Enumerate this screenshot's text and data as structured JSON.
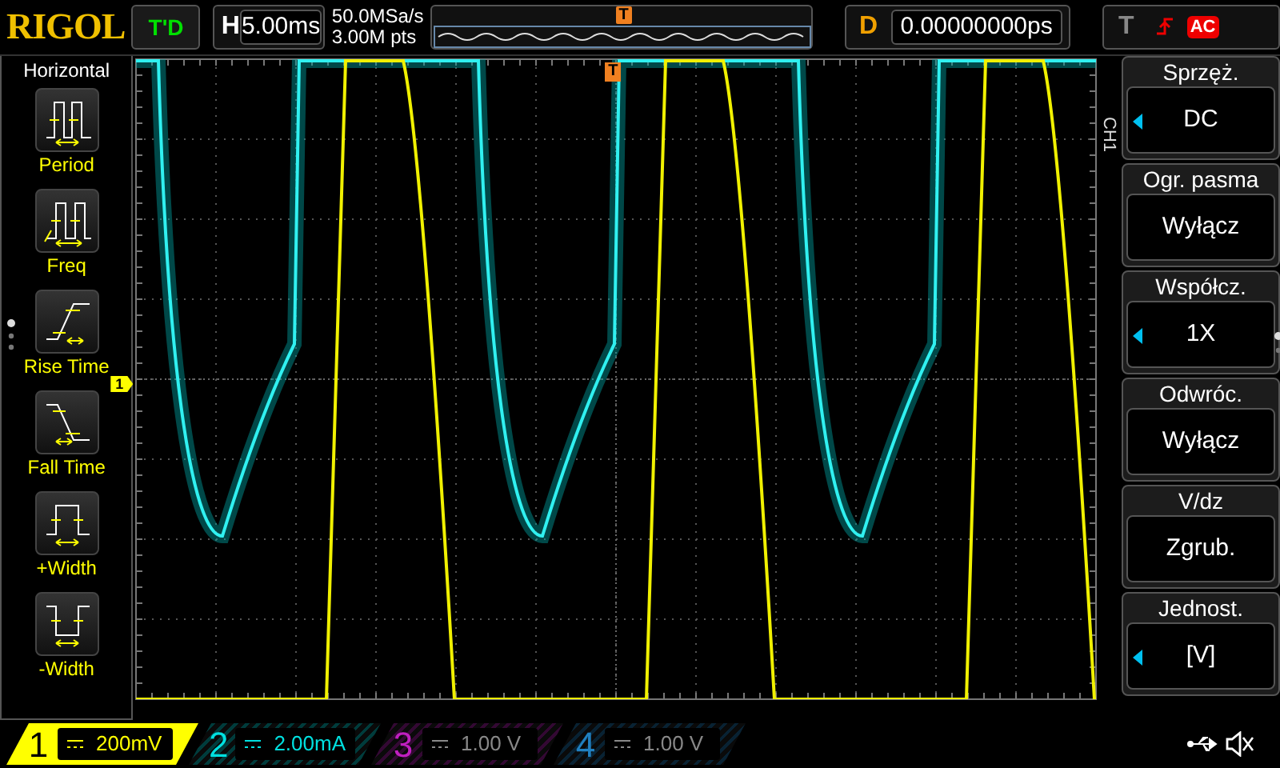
{
  "logo": "RIGOL",
  "run_status": "T'D",
  "timebase": {
    "label": "H",
    "value": "5.00ms"
  },
  "sample_rate": "50.0MSa/s",
  "memory_depth": "3.00M pts",
  "overview_trigger_marker": "T",
  "delay": {
    "label": "D",
    "value": "0.00000000ps"
  },
  "trigger": {
    "label": "T",
    "coupling": "AC"
  },
  "left_menu": {
    "title": "Horizontal",
    "items": [
      {
        "label": "Period",
        "kind": "period"
      },
      {
        "label": "Freq",
        "kind": "freq"
      },
      {
        "label": "Rise Time",
        "kind": "rise"
      },
      {
        "label": "Fall Time",
        "kind": "fall"
      },
      {
        "label": "+Width",
        "kind": "pwidth"
      },
      {
        "label": "-Width",
        "kind": "nwidth"
      }
    ]
  },
  "display": {
    "trigger_marker": "T",
    "channel_marker": "1"
  },
  "right_menu": {
    "channel": "CH1",
    "items": [
      {
        "label": "Sprzęż.",
        "value": "DC",
        "adjustable": true
      },
      {
        "label": "Ogr. pasma",
        "value": "Wyłącz",
        "adjustable": false
      },
      {
        "label": "Współcz.",
        "value": "1X",
        "adjustable": true
      },
      {
        "label": "Odwróc.",
        "value": "Wyłącz",
        "adjustable": false
      },
      {
        "label": "V/dz",
        "value": "Zgrub.",
        "adjustable": false
      },
      {
        "label": "Jednost.",
        "value": "[V]",
        "adjustable": true
      }
    ]
  },
  "channels": [
    {
      "number": "1",
      "scale": "200mV",
      "color": "#ffff00",
      "on": true,
      "selected": true
    },
    {
      "number": "2",
      "scale": "2.00mA",
      "color": "#00e0e0",
      "on": true,
      "selected": false
    },
    {
      "number": "3",
      "scale": "1.00 V",
      "color": "#c020c0",
      "on": false,
      "selected": false
    },
    {
      "number": "4",
      "scale": "1.00 V",
      "color": "#2080c0",
      "on": false,
      "selected": false
    }
  ]
}
